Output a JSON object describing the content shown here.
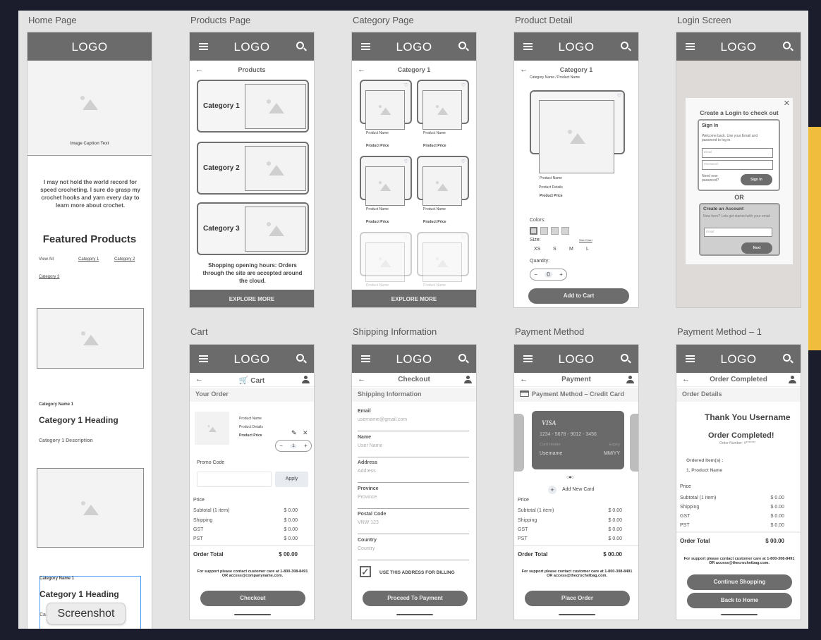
{
  "labels": {
    "home": "Home Page",
    "products": "Products Page",
    "category": "Category Page",
    "detail": "Product Detail",
    "login": "Login Screen",
    "cart": "Cart",
    "shipping": "Shipping Information",
    "payment": "Payment Method",
    "completed": "Payment Method – 1"
  },
  "logo": "LOGO",
  "home": {
    "caption": "Image Caption Text",
    "intro": "I may not hold the world record for speed crocheting. I sure do grasp my crochet hooks and yarn every day to learn more about crochet.",
    "featured": "Featured Products",
    "links": [
      "View All",
      "Category 1",
      "Category 2",
      "Category 3"
    ],
    "cat_name": "Category Name 1",
    "cat_heading": "Category 1 Heading",
    "cat_desc": "Category 1 Description",
    "cat_name2": "Category Name 1",
    "cat_heading2": "Category 1 Heading",
    "cut_text": "Ca",
    "tooltip": "Screenshot"
  },
  "products": {
    "title": "Products",
    "categories": [
      "Category 1",
      "Category 2",
      "Category 3"
    ],
    "hours": "Shopping opening hours: Orders through the site are accepted around the cloud.",
    "explore": "EXPLORE MORE"
  },
  "category": {
    "title": "Category 1",
    "product_name": "Product Name",
    "product_price": "Product Price",
    "explore": "EXPLORE MORE"
  },
  "detail": {
    "title": "Category 1",
    "breadcrumb": "Category Name / Product Name",
    "product_name": "Product Name",
    "product_details": "Product Details",
    "product_price": "Product Price",
    "colors_label": "Colors:",
    "size_label": "Size:",
    "size_chart": "Size Chart",
    "sizes": [
      "XS",
      "S",
      "M",
      "L"
    ],
    "quantity_label": "Quantity:",
    "quantity": "0",
    "add_to_cart": "Add to Cart"
  },
  "login": {
    "title": "Create a Login to check out",
    "sign_in_heading": "Sign In",
    "welcome": "Welcome back. Use your Email and password to log in.",
    "email_placeholder": "Email",
    "password_placeholder": "Password",
    "need_password": "Need new password?",
    "sign_in": "Sign In",
    "or": "OR",
    "create_heading": "Create an Account",
    "create_text": "New here? Lets get started with your email",
    "next": "Next"
  },
  "price": {
    "label": "Price",
    "rows": [
      {
        "label": "Subtotal (1 item)",
        "value": "$ 0.00"
      },
      {
        "label": "Shipping",
        "value": "$ 0.00"
      },
      {
        "label": "GST",
        "value": "$ 0.00"
      },
      {
        "label": "PST",
        "value": "$ 0.00"
      }
    ],
    "total_label": "Order Total",
    "total": "$ 00.00"
  },
  "cart": {
    "title": "Cart",
    "section": "Your Order",
    "product_name": "Product Name",
    "product_details": "Product Details",
    "product_price": "Product Price",
    "quantity": "1",
    "promo_label": "Promo Code",
    "apply": "Apply",
    "support": "For support please contact customer care at 1-800-308-8491 OR access@companyname.com.",
    "checkout": "Checkout"
  },
  "shipping": {
    "title": "Checkout",
    "section": "Shipping Information",
    "fields": [
      {
        "label": "Email",
        "value": "username@gmail.com"
      },
      {
        "label": "Name",
        "value": "User Name"
      },
      {
        "label": "Address",
        "value": "Address"
      },
      {
        "label": "Province",
        "value": "Province"
      },
      {
        "label": "Postal Code",
        "value": "VNW 123"
      },
      {
        "label": "Country",
        "value": "Country"
      }
    ],
    "billing_checkbox": "USE THIS ADDRESS FOR BILLING",
    "billing_checked": true,
    "proceed": "Proceed To Payment"
  },
  "payment": {
    "title": "Payment",
    "section": "Payment Method – Credit Card",
    "card": {
      "brand": "VISA",
      "number": "1234 - 5678 - 9012 - 3456",
      "holder_label": "Card Holder",
      "expiry_label": "Expiry",
      "holder": "Username",
      "expiry": "MM/YY"
    },
    "carousel_active": 2,
    "add_card": "Add New Card",
    "support": "For support please contact customer care at 1-800-308-8491 OR access@thecrochetbag.com.",
    "place_order": "Place Order"
  },
  "completed": {
    "title": "Order Completed",
    "section": "Order Details",
    "thanks": "Thank You Username",
    "order_completed": "Order Completed!",
    "order_number": "Order Number: #*******",
    "ordered_items": "Ordered Item(s) :",
    "item": "1.  Product Name",
    "support": "For support please contact customer care at 1-800-308-8491 OR access@thecrochetbag.com.",
    "continue": "Continue Shopping",
    "back_home": "Back to Home"
  },
  "colors": {
    "header": "#6b6b6b",
    "canvas": "#e4e4e4",
    "accent": "#f0bd3c",
    "selection": "#4a9cf5"
  }
}
